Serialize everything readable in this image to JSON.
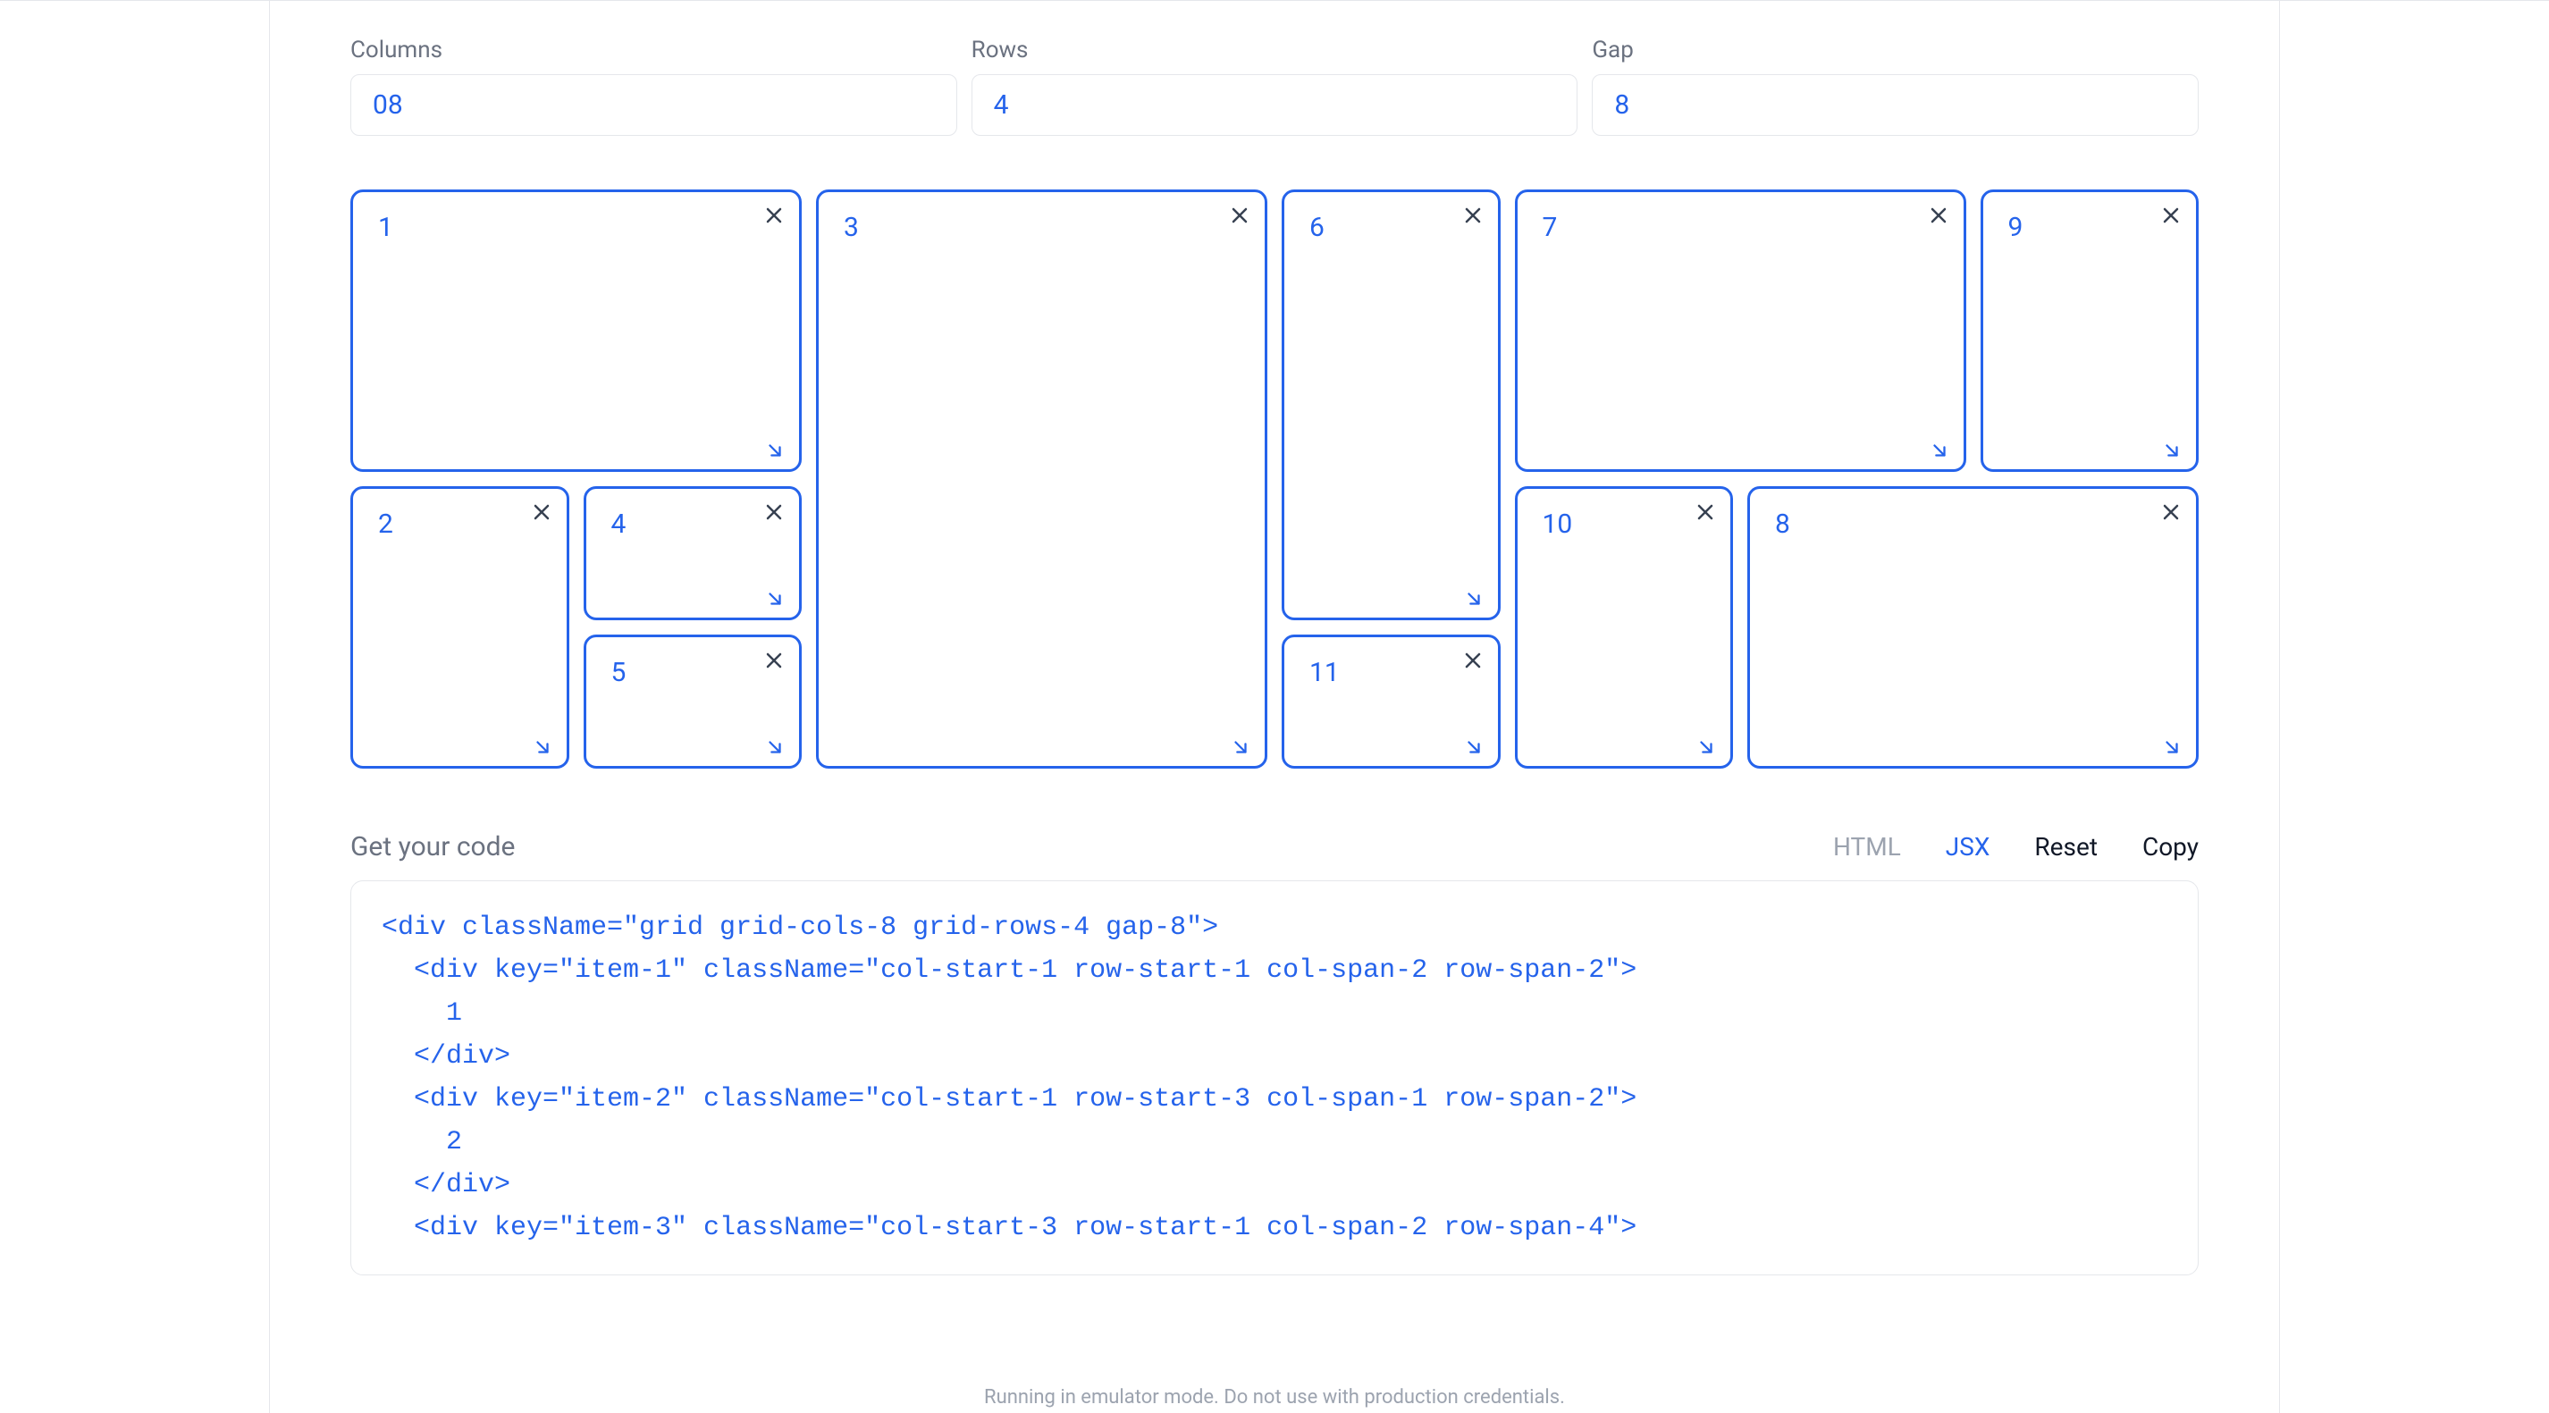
{
  "inputs": {
    "columns": {
      "label": "Columns",
      "value": "08"
    },
    "rows": {
      "label": "Rows",
      "value": "4"
    },
    "gap": {
      "label": "Gap",
      "value": "8"
    }
  },
  "grid": {
    "items": [
      {
        "id": "1",
        "col": 1,
        "row": 1,
        "colspan": 2,
        "rowspan": 2
      },
      {
        "id": "2",
        "col": 1,
        "row": 3,
        "colspan": 1,
        "rowspan": 2
      },
      {
        "id": "3",
        "col": 3,
        "row": 1,
        "colspan": 2,
        "rowspan": 4
      },
      {
        "id": "4",
        "col": 2,
        "row": 3,
        "colspan": 1,
        "rowspan": 1
      },
      {
        "id": "5",
        "col": 2,
        "row": 4,
        "colspan": 1,
        "rowspan": 1
      },
      {
        "id": "6",
        "col": 5,
        "row": 1,
        "colspan": 1,
        "rowspan": 3
      },
      {
        "id": "7",
        "col": 6,
        "row": 1,
        "colspan": 2,
        "rowspan": 2
      },
      {
        "id": "8",
        "col": 7,
        "row": 3,
        "colspan": 2,
        "rowspan": 2
      },
      {
        "id": "9",
        "col": 8,
        "row": 1,
        "colspan": 1,
        "rowspan": 2
      },
      {
        "id": "10",
        "col": 6,
        "row": 3,
        "colspan": 1,
        "rowspan": 2
      },
      {
        "id": "11",
        "col": 5,
        "row": 4,
        "colspan": 1,
        "rowspan": 1
      }
    ]
  },
  "codeSection": {
    "title": "Get your code",
    "tabs": {
      "html": "HTML",
      "jsx": "JSX"
    },
    "actions": {
      "reset": "Reset",
      "copy": "Copy"
    },
    "code": "<div className=\"grid grid-cols-8 grid-rows-4 gap-8\">\n  <div key=\"item-1\" className=\"col-start-1 row-start-1 col-span-2 row-span-2\">\n    1\n  </div>\n  <div key=\"item-2\" className=\"col-start-1 row-start-3 col-span-1 row-span-2\">\n    2\n  </div>\n  <div key=\"item-3\" className=\"col-start-3 row-start-1 col-span-2 row-span-4\">"
  },
  "footerNote": "Running in emulator mode. Do not use with production credentials."
}
